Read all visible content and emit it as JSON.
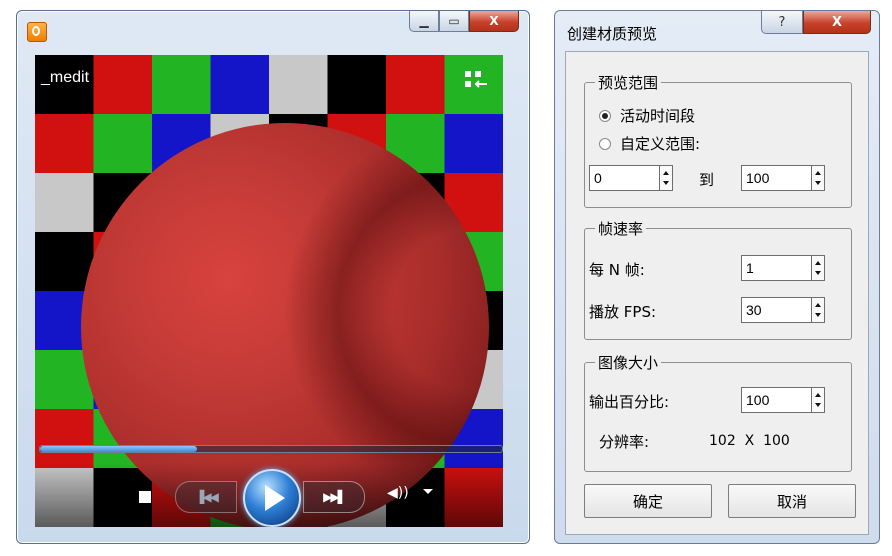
{
  "player": {
    "view_title": "_medit",
    "progress": 0.34,
    "icons": {
      "app": "media-player-icon",
      "minimize": "minimize-icon",
      "restore": "restore-icon",
      "close": "close-icon",
      "switch": "switch-to-library-icon",
      "stop": "stop-icon",
      "previous": "previous-icon",
      "play": "play-icon",
      "next": "next-icon",
      "volume": "volume-icon",
      "volume_menu": "chevron-down-icon"
    },
    "colors": {
      "sphere": "#c33a36",
      "checker": [
        "#d11010",
        "#22b422",
        "#1414c8",
        "#c8c8c8",
        "#000000"
      ]
    }
  },
  "dialog": {
    "title": "创建材质预览",
    "help_label": "?",
    "close_label": "X",
    "preview_range": {
      "title": "预览范围",
      "option_active": "活动时间段",
      "option_custom": "自定义范围:",
      "selected": "active",
      "from": "0",
      "to_label": "到",
      "to": "100"
    },
    "frame_rate": {
      "title": "帧速率",
      "every_n_label": "每 N 帧:",
      "every_n": "1",
      "fps_label": "播放 FPS:",
      "fps": "30"
    },
    "image_size": {
      "title": "图像大小",
      "percent_label": "输出百分比:",
      "percent": "100",
      "resolution_label": "分辨率:",
      "resolution": "102  X  100"
    },
    "ok_label": "确定",
    "cancel_label": "取消"
  }
}
